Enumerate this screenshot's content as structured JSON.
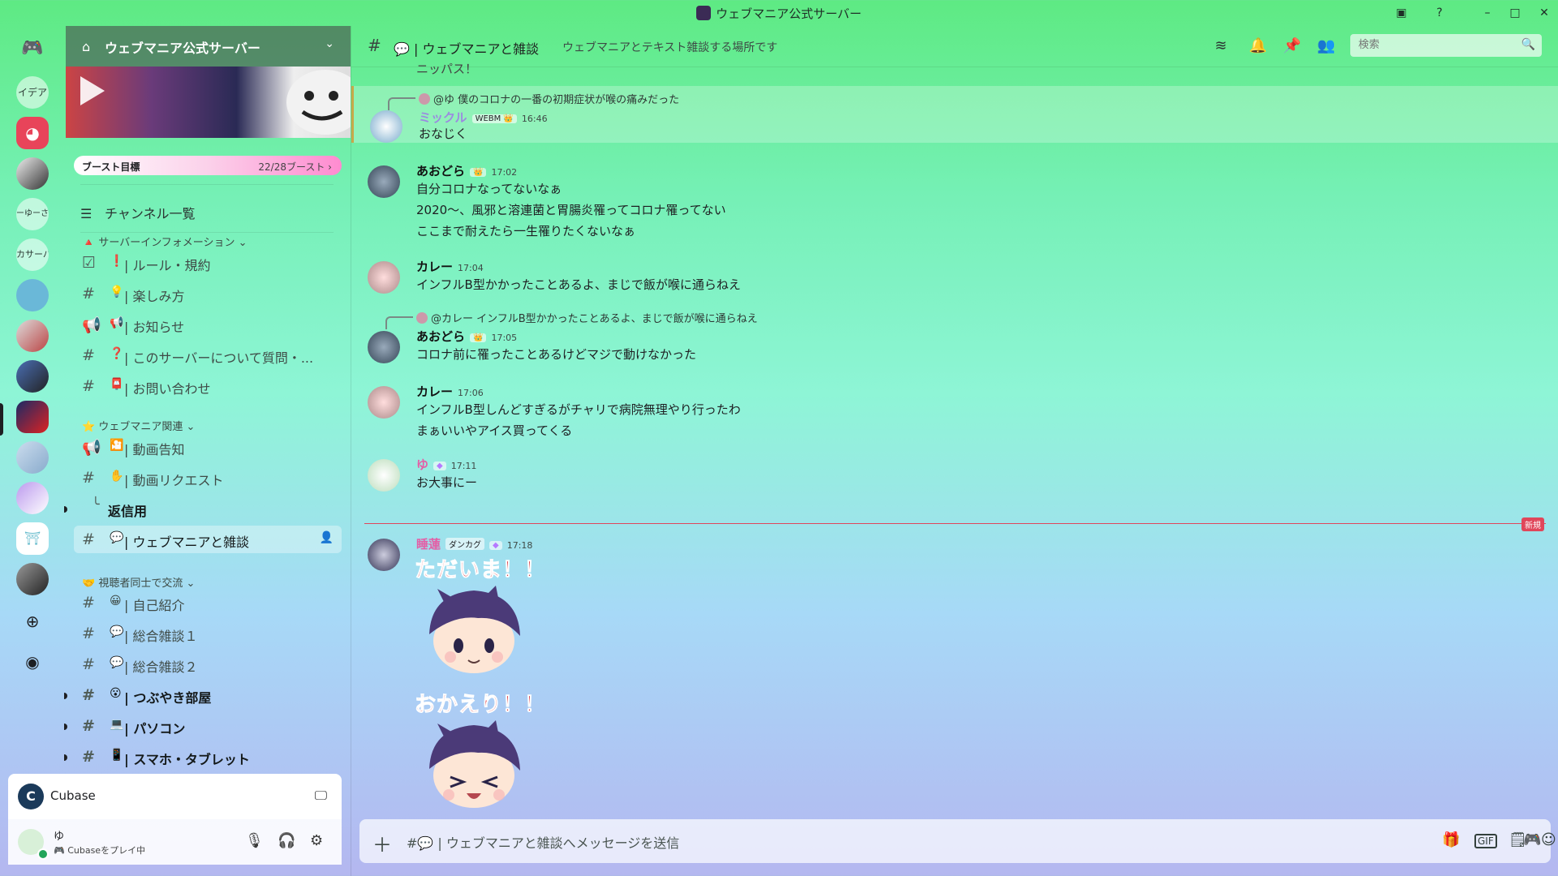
{
  "window": {
    "title": "ウェブマニア公式サーバー"
  },
  "rail": {
    "text_servers": [
      "イデア",
      "ーゆーさ",
      "カサーバ"
    ]
  },
  "server": {
    "name": "ウェブマニア公式サーバー",
    "boost_label": "ブースト目標",
    "boost_count": "22/28ブースト ›",
    "channel_browser": "チャンネル一覧"
  },
  "categories": [
    {
      "name": "サーバーインフォメーション ⌄"
    },
    {
      "name": "ウェブマニア関連 ⌄"
    },
    {
      "name": "視聴者同士で交流 ⌄"
    }
  ],
  "channels": [
    {
      "emoji": "❗",
      "label": "| ルール・規約"
    },
    {
      "emoji": "💡",
      "label": "| 楽しみ方"
    },
    {
      "emoji": "📢",
      "label": "| お知らせ"
    },
    {
      "emoji": "❓",
      "label": "| このサーバーについて質問・..."
    },
    {
      "emoji": "📮",
      "label": "| お問い合わせ"
    },
    {
      "emoji": "🎦",
      "label": "| 動画告知"
    },
    {
      "emoji": "✋",
      "label": "| 動画リクエスト"
    },
    {
      "label": "返信用"
    },
    {
      "emoji": "💬",
      "label": "| ウェブマニアと雑談"
    },
    {
      "emoji": "😀",
      "label": "| 自己紹介"
    },
    {
      "emoji": "💬",
      "label": "| 総合雑談１"
    },
    {
      "emoji": "💬",
      "label": "| 総合雑談２"
    },
    {
      "emoji": "😮",
      "label": "| つぶやき部屋"
    },
    {
      "emoji": "💻",
      "label": "| パソコン"
    },
    {
      "emoji": "📱",
      "label": "| スマホ・タブレット"
    }
  ],
  "activity": {
    "app": "Cubase"
  },
  "user": {
    "name": "ゆ",
    "status": "Cubaseをプレイ中"
  },
  "channel": {
    "name": "| ウェブマニアと雑談",
    "topic": "ウェブマニアとテキスト雑談する場所です",
    "search_placeholder": "検索"
  },
  "messages": [
    {
      "author": "",
      "time": "",
      "lines": [
        "ニッパス！"
      ]
    },
    {
      "reply_to": "@ゆ 僕のコロナの一番の初期症状が喉の痛みだった",
      "author": "ミックル",
      "badge": "WEBM 👑",
      "time": "16:46",
      "lines": [
        "おなじく"
      ]
    },
    {
      "author": "あおどら",
      "badge": "👑",
      "time": "17:02",
      "lines": [
        "自分コロナなってないなぁ",
        "2020～、風邪と溶連菌と胃腸炎罹ってコロナ罹ってない",
        "ここまで耐えたら一生罹りたくないなぁ"
      ]
    },
    {
      "author": "カレー",
      "time": "17:04",
      "lines": [
        "インフルB型かかったことあるよ、まじで飯が喉に通らねえ"
      ]
    },
    {
      "reply_to": "@カレー インフルB型かかったことあるよ、まじで飯が喉に通らねえ",
      "author": "あおどら",
      "badge": "👑",
      "time": "17:05",
      "lines": [
        "コロナ前に罹ったことあるけどマジで動けなかった"
      ]
    },
    {
      "author": "カレー",
      "time": "17:06",
      "lines": [
        "インフルB型しんどすぎるがチャリで病院無理やり行ったわ",
        "まぁいいやアイス買ってくる"
      ]
    },
    {
      "author": "ゆ",
      "time": "17:11",
      "lines": [
        "お大事にー"
      ]
    },
    {
      "author": "睡蓮",
      "badge": "ダンカグ",
      "time": "17:18",
      "lines": [],
      "stickers": [
        "ただいま！！",
        "おかえり！！"
      ]
    }
  ],
  "new_label": "新規",
  "composer": {
    "placeholder": "| ウェブマニアと雑談へメッセージを送信"
  },
  "colors": {
    "accent": "#5865f2",
    "mention_pink": "#e35fa6",
    "new_red": "#e0465a"
  }
}
